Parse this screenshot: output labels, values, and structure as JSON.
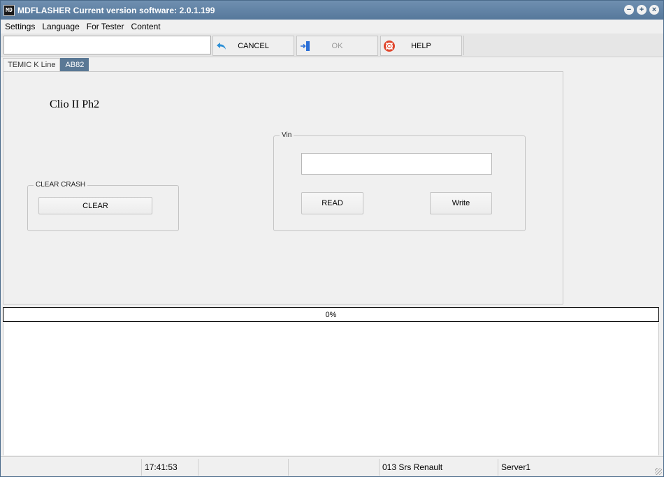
{
  "window": {
    "app_name": "MDFLASHER",
    "title": "MDFLASHER  Current version software: 2.0.1.199",
    "icon_text": "MD",
    "controls": {
      "minimize": "−",
      "maximize": "+",
      "close": "×"
    }
  },
  "menu": [
    {
      "label": "Settings"
    },
    {
      "label": "Language"
    },
    {
      "label": "For Tester"
    },
    {
      "label": "Content"
    }
  ],
  "toolbar": {
    "search_value": "",
    "cancel_label": "CANCEL",
    "ok_label": "OK",
    "help_label": "HELP",
    "ok_enabled": false
  },
  "tabs": [
    {
      "label": "TEMIC K Line",
      "active": false
    },
    {
      "label": "AB82",
      "active": true
    }
  ],
  "panel": {
    "model": "Clio II Ph2",
    "clear_crash": {
      "legend": "CLEAR CRASH",
      "button": "CLEAR"
    },
    "vin": {
      "legend": "Vin",
      "value": "",
      "read_button": "READ",
      "write_button": "Write"
    }
  },
  "progress": {
    "text": "0%",
    "value": 0
  },
  "statusbar": {
    "cells": [
      "",
      "17:41:53",
      "",
      "",
      "013 Srs Renault",
      "Server1"
    ]
  },
  "colors": {
    "titlebar": "#5f81a4",
    "active_tab": "#5a7895",
    "help_icon": "#e0452b",
    "cancel_icon": "#2b8fd6",
    "ok_icon": "#2b6fd6"
  },
  "icons": {
    "cancel": "undo-arrow-icon",
    "ok": "exit-door-icon",
    "help": "lifebuoy-icon"
  }
}
